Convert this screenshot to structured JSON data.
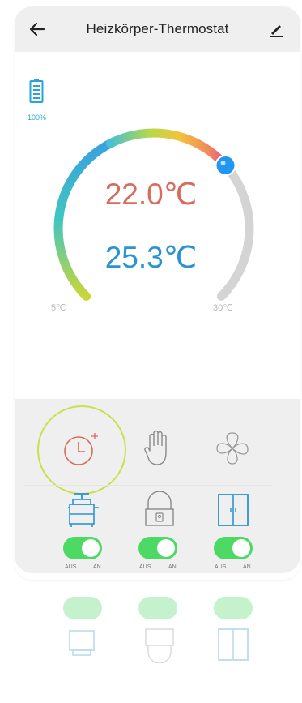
{
  "header": {
    "title": "Heizkörper-Thermostat"
  },
  "battery": {
    "level": "100%"
  },
  "dial": {
    "set_temperature": "22.0℃",
    "current_temperature": "25.3℃",
    "min_label": "5℃",
    "max_label": "30℃",
    "setpoint_fraction": 0.68
  },
  "modes": [
    {
      "name": "schedule",
      "icon": "clock-plus-icon",
      "selected": true
    },
    {
      "name": "manual",
      "icon": "hand-icon",
      "selected": false
    },
    {
      "name": "eco",
      "icon": "flower-icon",
      "selected": false
    }
  ],
  "features": [
    {
      "name": "heater",
      "icon": "radiator-icon",
      "off_label": "AUS",
      "on_label": "AN",
      "state": "on"
    },
    {
      "name": "lock",
      "icon": "lock-icon",
      "off_label": "AUS",
      "on_label": "AN",
      "state": "on"
    },
    {
      "name": "window",
      "icon": "window-icon",
      "off_label": "AUS",
      "on_label": "AN",
      "state": "on"
    }
  ],
  "colors": {
    "set_temp": "#d76b5e",
    "current_temp": "#2a93d4",
    "toggle_on": "#4cd964",
    "selected_ring": "#c9e04a",
    "knob": "#2196f3"
  }
}
